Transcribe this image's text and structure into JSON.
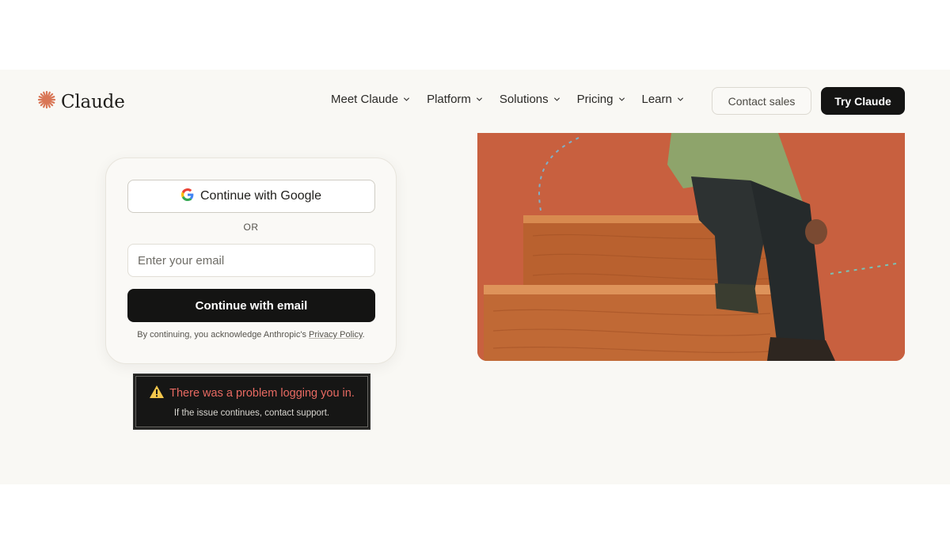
{
  "header": {
    "brand": "Claude",
    "nav": [
      {
        "label": "Meet Claude"
      },
      {
        "label": "Platform"
      },
      {
        "label": "Solutions"
      },
      {
        "label": "Pricing"
      },
      {
        "label": "Learn"
      }
    ],
    "contact_sales": "Contact sales",
    "try_claude": "Try Claude"
  },
  "login": {
    "google_label": "Continue with Google",
    "or_text": "OR",
    "email_placeholder": "Enter your email",
    "email_value": "",
    "email_button": "Continue with email",
    "legal_prefix": "By continuing, you acknowledge Anthropic's ",
    "legal_link": "Privacy Policy",
    "legal_suffix": "."
  },
  "error": {
    "title": "There was a problem logging you in.",
    "message": "If the issue continues, contact support."
  },
  "colors": {
    "brand_accent": "#d97757",
    "primary_button": "#141413",
    "error_text": "#e86a62",
    "page_background": "#f9f8f4"
  },
  "icons": {
    "logo": "claude-starburst-icon",
    "nav_chevron": "chevron-down-icon",
    "google": "google-g-icon",
    "warning": "warning-triangle-icon"
  }
}
